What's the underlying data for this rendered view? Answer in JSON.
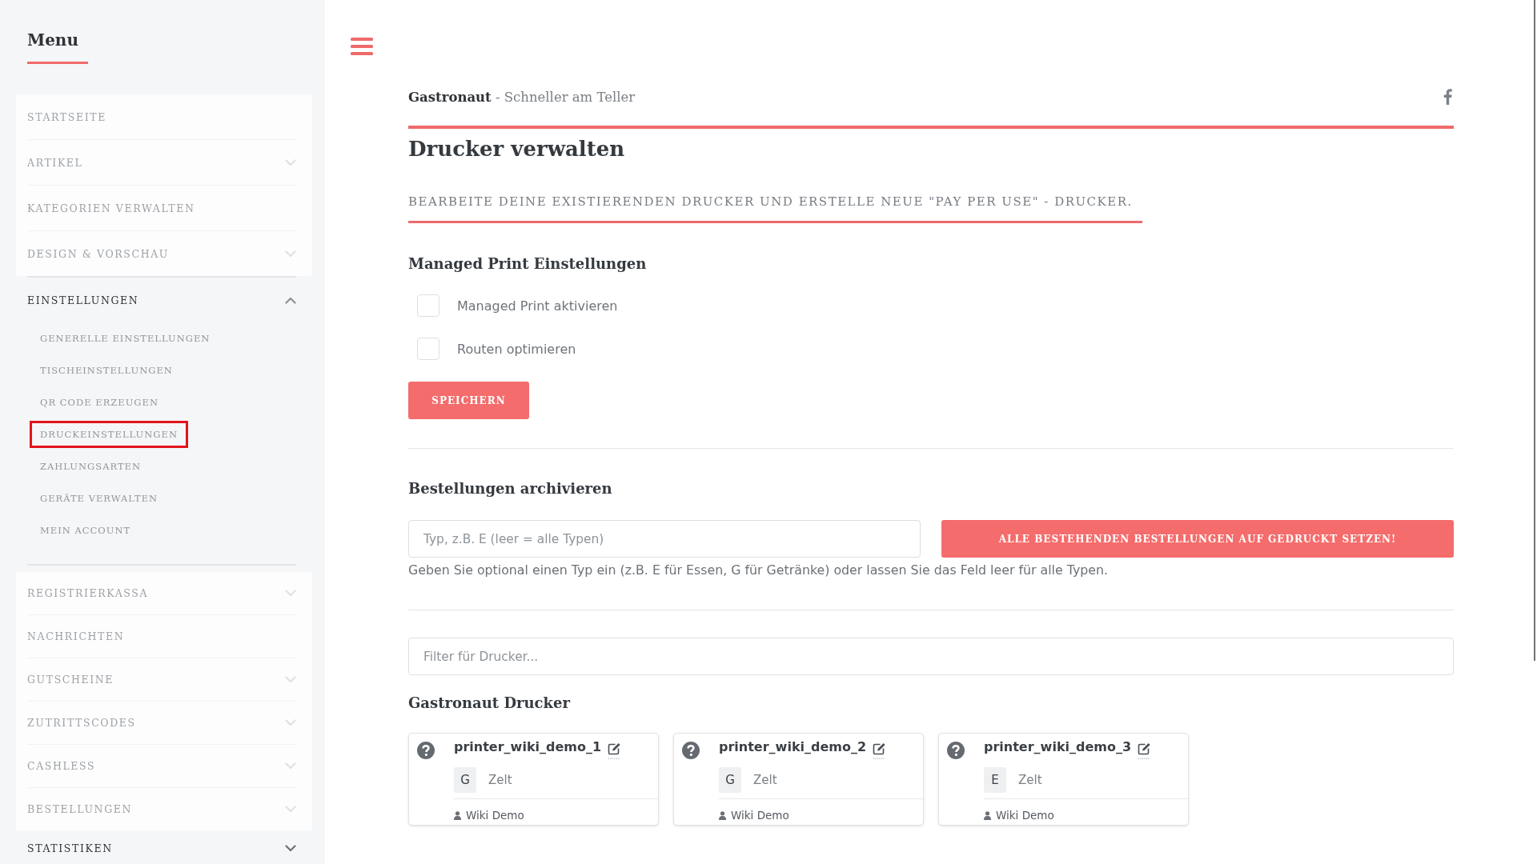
{
  "sidebar": {
    "title": "Menu",
    "items": [
      {
        "label": "STARTSEITE",
        "kind": "link",
        "dimmed": true
      },
      {
        "label": "ARTIKEL",
        "kind": "group",
        "dimmed": true,
        "expanded": false
      },
      {
        "label": "KATEGORIEN VERWALTEN",
        "kind": "link",
        "dimmed": true
      },
      {
        "label": "DESIGN & VORSCHAU",
        "kind": "group",
        "dimmed": true,
        "expanded": false
      },
      {
        "label": "EINSTELLUNGEN",
        "kind": "group",
        "dimmed": false,
        "expanded": true,
        "children": [
          {
            "label": "GENERELLE EINSTELLUNGEN",
            "selected": false
          },
          {
            "label": "TISCHEINSTELLUNGEN",
            "selected": false
          },
          {
            "label": "QR CODE ERZEUGEN",
            "selected": false
          },
          {
            "label": "DRUCKEINSTELLUNGEN",
            "selected": true
          },
          {
            "label": "ZAHLUNGSARTEN",
            "selected": false
          },
          {
            "label": "GERÄTE VERWALTEN",
            "selected": false
          },
          {
            "label": "MEIN ACCOUNT",
            "selected": false
          }
        ]
      },
      {
        "label": "REGISTRIERKASSA",
        "kind": "group",
        "dimmed": true,
        "expanded": false
      },
      {
        "label": "NACHRICHTEN",
        "kind": "link",
        "dimmed": true
      },
      {
        "label": "GUTSCHEINE",
        "kind": "group",
        "dimmed": true,
        "expanded": false
      },
      {
        "label": "ZUTRITTSCODES",
        "kind": "group",
        "dimmed": true,
        "expanded": false
      },
      {
        "label": "CASHLESS",
        "kind": "group",
        "dimmed": true,
        "expanded": false
      },
      {
        "label": "BESTELLUNGEN",
        "kind": "group",
        "dimmed": true,
        "expanded": false
      },
      {
        "label": "STATISTIKEN",
        "kind": "group",
        "dimmed": false,
        "expanded": false
      }
    ]
  },
  "header": {
    "title": "**Gastronaut** - Schneller am Teller"
  },
  "page": {
    "title": "Drucker verwalten",
    "subtitle": "BEARBEITE DEINE EXISTIERENDEN DRUCKER UND ERSTELLE NEUE \"PAY PER USE\" - DRUCKER."
  },
  "managed_print": {
    "heading": "Managed Print Einstellungen",
    "options": [
      {
        "label": "Managed Print aktivieren",
        "checked": false
      },
      {
        "label": "Routen optimieren",
        "checked": false
      }
    ],
    "save_button": "SPEICHERN"
  },
  "archive": {
    "heading": "Bestellungen archivieren",
    "type_field": {
      "placeholder": "Typ, z.B. E (leer = alle Typen)"
    },
    "button": "ALLE BESTEHENDEN BESTELLUNGEN AUF GEDRUCKT SETZEN!",
    "help": "Geben Sie optional einen Typ ein (z.B. E für Essen, G für Getränke) oder lassen Sie das Feld leer für alle Typen."
  },
  "printer_filter": {
    "placeholder": "Filter für Drucker..."
  },
  "printers": {
    "heading": "Gastronaut Drucker",
    "cards": [
      {
        "name": "printer_wiki_demo_1",
        "type": "G",
        "location": "Zelt",
        "owner": "Wiki Demo"
      },
      {
        "name": "printer_wiki_demo_2",
        "type": "G",
        "location": "Zelt",
        "owner": "Wiki Demo"
      },
      {
        "name": "printer_wiki_demo_3",
        "type": "E",
        "location": "Zelt",
        "owner": "Wiki Demo"
      }
    ]
  }
}
